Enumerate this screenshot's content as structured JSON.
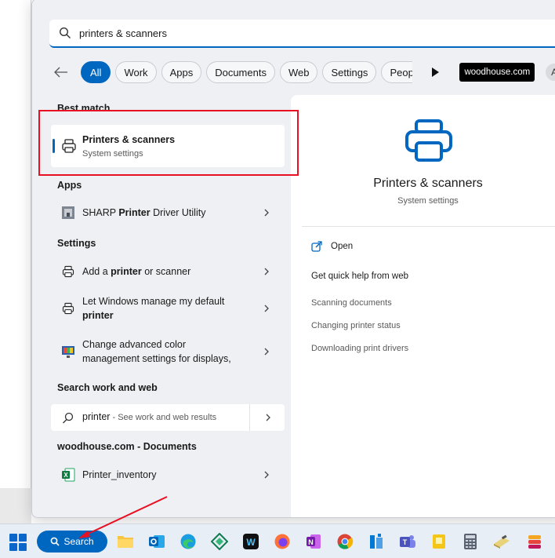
{
  "search": {
    "query": "printers & scanners"
  },
  "filters": {
    "chips": [
      "All",
      "Work",
      "Apps",
      "Documents",
      "Web",
      "Settings",
      "Peop"
    ],
    "org": "woodhouse.com",
    "avatar": "A",
    "more": "···"
  },
  "best_match": {
    "header": "Best match",
    "title": "Printers & scanners",
    "subtitle": "System settings"
  },
  "apps": {
    "header": "Apps",
    "items": [
      {
        "pre": "SHARP ",
        "bold": "Printer",
        "post": " Driver Utility"
      }
    ]
  },
  "settings": {
    "header": "Settings",
    "items": [
      {
        "pre": "Add a ",
        "bold": "printer",
        "post": " or scanner"
      },
      {
        "pre": "Let Windows manage my default",
        "bold": "printer",
        "post": ""
      },
      {
        "pre": "Change advanced color",
        "line2": "management settings for displays,"
      }
    ]
  },
  "web": {
    "header": "Search work and web",
    "query": "printer",
    "suffix": " - See work and web results"
  },
  "documents": {
    "header": "woodhouse.com - Documents",
    "items": [
      {
        "name": "Printer_inventory"
      }
    ]
  },
  "preview": {
    "title": "Printers & scanners",
    "subtitle": "System settings",
    "open_label": "Open",
    "help_header": "Get quick help from web",
    "links": [
      "Scanning documents",
      "Changing printer status",
      "Downloading print drivers"
    ]
  },
  "taskbar": {
    "search_label": "Search",
    "apps": [
      "file-explorer",
      "outlook",
      "edge",
      "power-automate",
      "app-w",
      "firefox",
      "onenote",
      "chrome",
      "azure-data",
      "teams",
      "sticky-notes",
      "calculator",
      "paint-tool",
      "stack-app"
    ]
  },
  "colors": {
    "accent": "#0067c0",
    "highlight_box": "#e81123",
    "annotation_arrow": "#e81123"
  }
}
